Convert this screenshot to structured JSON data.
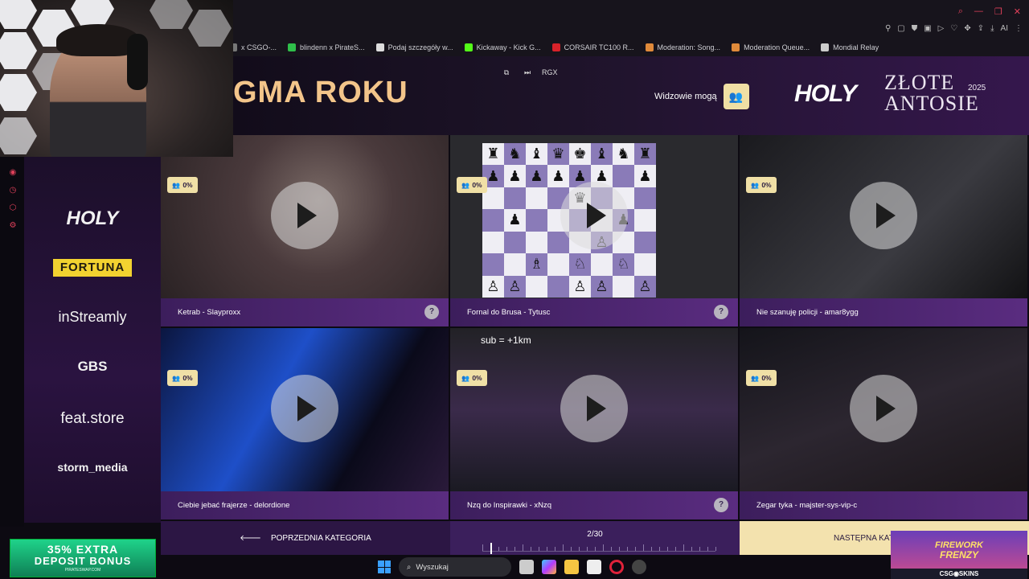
{
  "browser": {
    "bookmarks": [
      {
        "label": "x CSGO-...",
        "color": "#777777"
      },
      {
        "label": "blindenn x PirateS...",
        "color": "#2fbf4a"
      },
      {
        "label": "Podaj szczegóły w...",
        "color": "#dddddd"
      },
      {
        "label": "Kickaway - Kick G...",
        "color": "#53fc18"
      },
      {
        "label": "CORSAIR TC100 R...",
        "color": "#d8222a"
      },
      {
        "label": "Moderation: Song...",
        "color": "#e08a3a"
      },
      {
        "label": "Moderation Queue...",
        "color": "#e08a3a"
      },
      {
        "label": "Mondial Relay",
        "color": "#cccccc"
      }
    ],
    "extension_ai_label": "AI"
  },
  "banner": {
    "category_title": "GMA ROKU",
    "controls": {
      "popout_icon": "popout-icon",
      "skip_icon": "skip-icon",
      "rgx_label": "RGX"
    },
    "viewers_label": "Widzowie mogą",
    "viewers_icon": "users-icon",
    "logo_text": "HOLY",
    "award_line1": "ZŁOTE",
    "award_line2": "ANTOSIE",
    "award_year": "2025"
  },
  "sidebar": {
    "sponsors": [
      "HOLY",
      "FORTUNA",
      "inStreamly",
      "GBS",
      "feat.store",
      "storm_media"
    ],
    "rail_icons": [
      "record-icon",
      "clock-icon",
      "hexagon-icon",
      "gear-icon"
    ]
  },
  "tiles": [
    {
      "title": "Ketrab - Slayproxx",
      "percent": "0%",
      "help": true,
      "theme": "map"
    },
    {
      "title": "Fornal do Brusa - Tytusc",
      "percent": "0%",
      "help": true,
      "theme": "chess"
    },
    {
      "title": "Nie szanuję policji - amar8ygg",
      "percent": "0%",
      "help": false,
      "theme": "dark"
    },
    {
      "title": "Ciebie jebać frajerze - delordione",
      "percent": "0%",
      "help": false,
      "theme": "stage"
    },
    {
      "title": "Nzq do Inspirawki - xNzq",
      "percent": "0%",
      "help": true,
      "theme": "stream",
      "overlay": "sub = +1km"
    },
    {
      "title": "Zegar tyka - majster-sys-vip-c",
      "percent": "0%",
      "help": false,
      "theme": "desk"
    }
  ],
  "nav": {
    "prev_label": "POPRZEDNIA KATEGORIA",
    "progress_label": "2/30",
    "progress": 0.033,
    "next_label": "NASTĘPNA KAT"
  },
  "ads": {
    "promo_line1": "35% EXTRA",
    "promo_line2": "DEPOSIT BONUS",
    "promo_line3": "PIRATESWAP.COM",
    "firework_line1": "FIREWORK",
    "firework_line2": "FRENZY",
    "firework_brand": "CSG◉SKINS"
  },
  "taskbar": {
    "search_placeholder": "Wyszukaj"
  },
  "chess_board": [
    "rnbqkbnr",
    "pppppp.p",
    "....q...",
    ".p....p.",
    ".....P..",
    "..B.N.N.",
    "PP..PP.P"
  ]
}
